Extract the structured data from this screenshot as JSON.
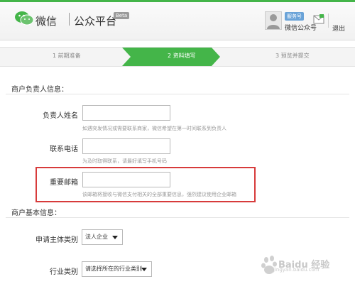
{
  "header": {
    "brand": "微信",
    "platform": "公众平台",
    "beta": "Beta",
    "service_badge": "服务号",
    "account_name": "微信公众号",
    "logout": "退出"
  },
  "steps": [
    {
      "label": "1 前期准备",
      "active": false
    },
    {
      "label": "2 资料填写",
      "active": true
    },
    {
      "label": "3 预览并提交",
      "active": false
    }
  ],
  "sections": {
    "contact_title": "商户负责人信息：",
    "basic_title": "商户基本信息："
  },
  "fields": {
    "name": {
      "label": "负责人姓名",
      "value": "",
      "hint": "如遇突发情况或需要联系商家，微信希望在第一时间联系到负责人"
    },
    "phone": {
      "label": "联系电话",
      "value": "",
      "hint": "为及时取得联系，请最好填写手机号码"
    },
    "email": {
      "label": "重要邮箱",
      "value": "",
      "hint": "该邮箱将接收与微信支付相关的全部重要信息，强烈建议使用企业邮箱"
    }
  },
  "selects": {
    "entity_type": {
      "label": "申请主体类别",
      "selected": "法人企业"
    },
    "industry": {
      "label": "行业类别",
      "selected": "请选择所在的行业类别"
    }
  },
  "colors": {
    "accent_green": "#44b549",
    "highlight_red": "#d73b3b"
  },
  "watermark": {
    "text": "Baidu 经验",
    "url": "jingyan.baidu.com"
  }
}
